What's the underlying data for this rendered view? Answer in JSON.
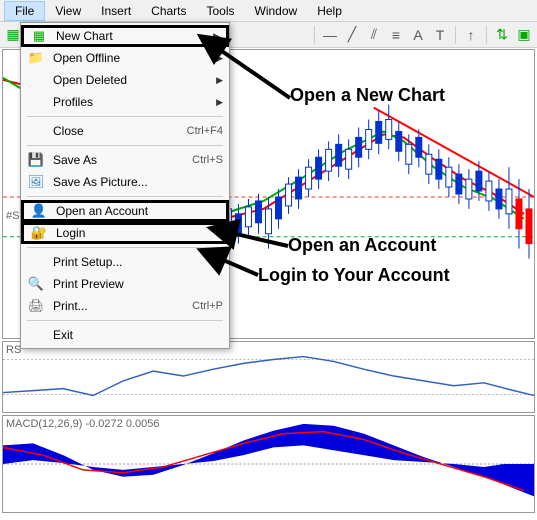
{
  "menubar": {
    "items": [
      "File",
      "View",
      "Insert",
      "Charts",
      "Tools",
      "Window",
      "Help"
    ],
    "active_index": 0
  },
  "dropdown": {
    "items": [
      {
        "label": "New Chart",
        "icon": "chart",
        "submenu": true,
        "highlighted": true
      },
      {
        "label": "Open Offline",
        "icon": "folder",
        "submenu": true
      },
      {
        "label": "Open Deleted",
        "icon": "",
        "submenu": true
      },
      {
        "label": "Profiles",
        "icon": "",
        "submenu": true
      },
      {
        "sep": true
      },
      {
        "label": "Close",
        "icon": "",
        "shortcut": "Ctrl+F4"
      },
      {
        "sep": true
      },
      {
        "label": "Save As",
        "icon": "disk",
        "shortcut": "Ctrl+S"
      },
      {
        "label": "Save As Picture...",
        "icon": "picture"
      },
      {
        "sep": true
      },
      {
        "label": "Open an Account",
        "icon": "user-plus",
        "highlighted": true
      },
      {
        "label": "Login",
        "icon": "user-lock",
        "highlighted": true
      },
      {
        "sep": true
      },
      {
        "label": "Print Setup...",
        "icon": ""
      },
      {
        "label": "Print Preview",
        "icon": "preview"
      },
      {
        "label": "Print...",
        "icon": "printer",
        "shortcut": "Ctrl+P"
      },
      {
        "sep": true
      },
      {
        "label": "Exit",
        "icon": ""
      }
    ]
  },
  "annotations": {
    "new_chart": "Open a New Chart",
    "open_account": "Open an Account",
    "login": "Login to Your Account"
  },
  "panels": {
    "symbol": "#S",
    "rsi_label": "RS",
    "macd_label": "MACD(12,26,9) -0.0272 0.0056"
  },
  "colors": {
    "ma_red": "#ff0000",
    "ma_green": "#00aa00",
    "level_green": "#11aa33",
    "level_red": "#ff3333",
    "rsi_line": "#3060c0",
    "macd_fill": "#0000dd",
    "macd_signal": "#ff0000"
  }
}
